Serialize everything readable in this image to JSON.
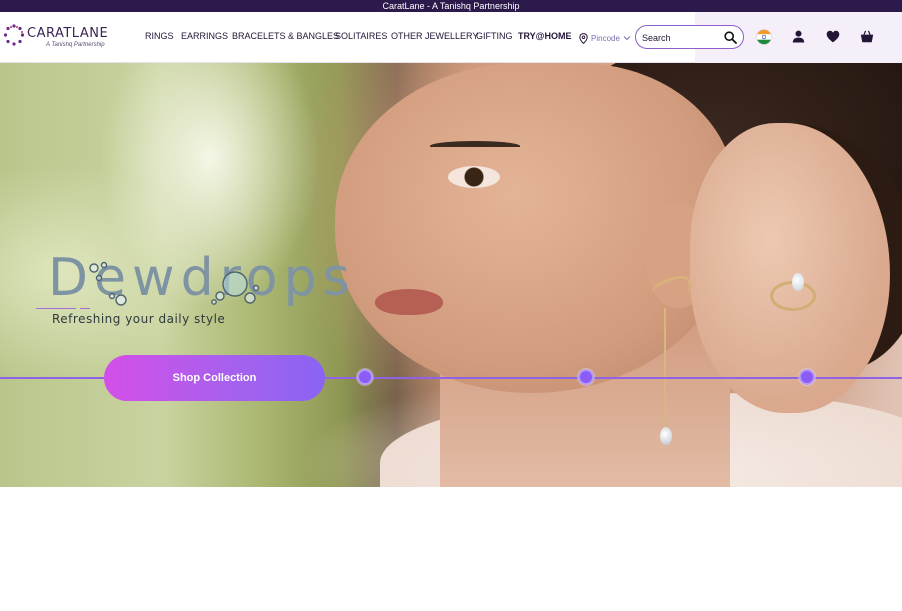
{
  "announcement": "CaratLane - A Tanishq Partnership",
  "logo": {
    "wordmark": "CARATLANE",
    "tagline": "A Tanishq Partnership"
  },
  "nav": [
    {
      "label": "RINGS"
    },
    {
      "label": "EARRINGS"
    },
    {
      "label": "BRACELETS & BANGLES"
    },
    {
      "label": "SOLITAIRES"
    },
    {
      "label": "OTHER JEWELLERY"
    },
    {
      "label": "GIFTING"
    },
    {
      "label": "TRY@HOME"
    }
  ],
  "pincode": {
    "label": "Pincode",
    "icon": "map-pin-icon"
  },
  "search": {
    "placeholder": "Search",
    "value": "",
    "icon": "search-icon"
  },
  "header_icons": [
    "india-flag-icon",
    "user-icon",
    "heart-icon",
    "cart-icon"
  ],
  "hero": {
    "title": "Dewdrops",
    "subtitle": "Refreshing your daily style",
    "cta_label": "Shop Collection",
    "slides": 4,
    "active_slide": 0
  },
  "colors": {
    "topbar_bg": "#2c1a4d",
    "accent_purple": "#8b5cf6",
    "cta_start": "#d34fe8",
    "cta_end": "#8a63f2",
    "nav_text": "#231535"
  }
}
